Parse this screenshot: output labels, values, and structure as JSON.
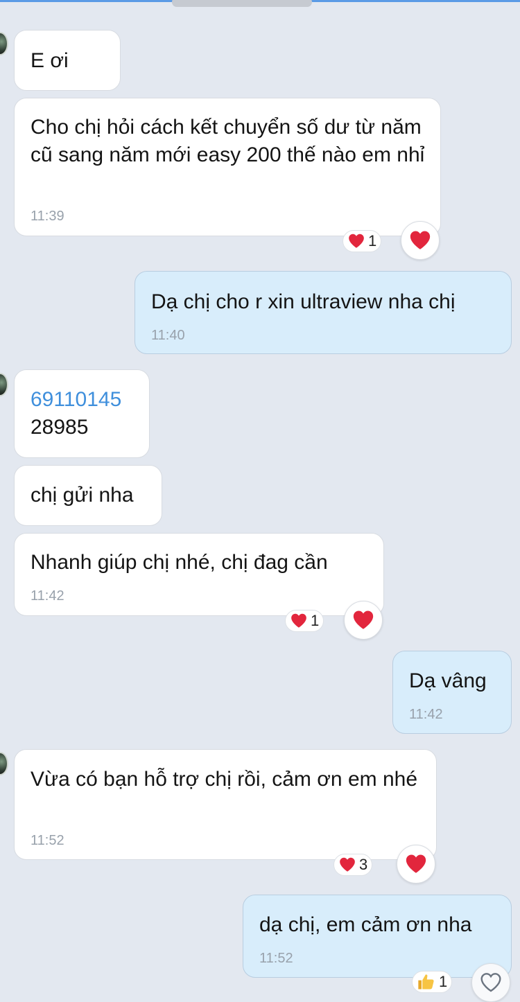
{
  "messages": [
    {
      "id": "m1",
      "direction": "incoming",
      "text": "E ơi"
    },
    {
      "id": "m2",
      "direction": "incoming",
      "text": "Cho chị hỏi cách kết chuyển số dư từ năm cũ sang năm mới easy 200 thế nào em nhỉ",
      "time": "11:39",
      "reaction": {
        "icon": "heart-icon",
        "count": "1"
      }
    },
    {
      "id": "m3",
      "direction": "outgoing",
      "text": "Dạ chị cho r xin ultraview nha chị",
      "time": "11:40"
    },
    {
      "id": "m4",
      "direction": "incoming",
      "link_text": "69110145",
      "text": "28985"
    },
    {
      "id": "m5",
      "direction": "incoming",
      "text": "chị gửi nha"
    },
    {
      "id": "m6",
      "direction": "incoming",
      "text": "Nhanh giúp chị nhé, chị đag cần",
      "time": "11:42",
      "reaction": {
        "icon": "heart-icon",
        "count": "1"
      }
    },
    {
      "id": "m7",
      "direction": "outgoing",
      "text": "Dạ vâng",
      "time": "11:42"
    },
    {
      "id": "m8",
      "direction": "incoming",
      "text": "Vừa có bạn hỗ trợ chị rồi, cảm ơn em nhé",
      "time": "11:52",
      "reaction": {
        "icon": "heart-icon",
        "count": "3"
      }
    },
    {
      "id": "m9",
      "direction": "outgoing",
      "text": "dạ chị, em cảm ơn nha",
      "time": "11:52",
      "reaction": {
        "icon": "thumbs-up-icon",
        "count": "1"
      }
    }
  ],
  "colors": {
    "incoming": "#ffffff",
    "outgoing": "#d8edfb",
    "link": "#3f8fdc",
    "heart": "#e2263d",
    "background": "#e3e8f0"
  }
}
